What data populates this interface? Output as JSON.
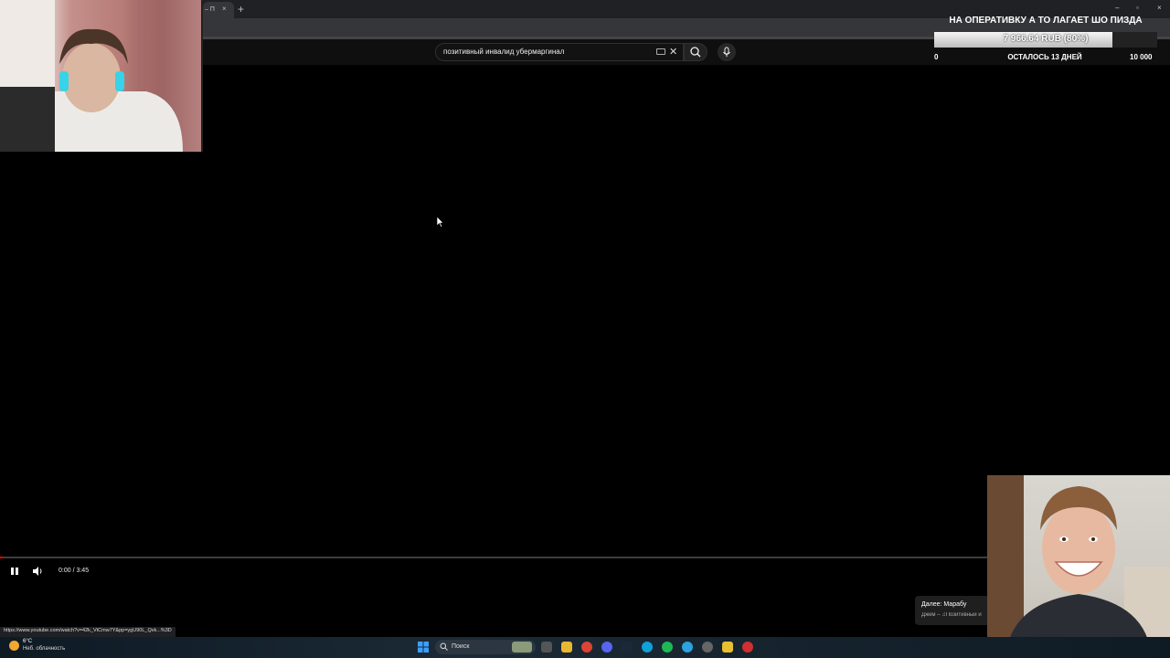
{
  "browser": {
    "tab_label": "– П",
    "tab_close": "×",
    "new_tab": "+",
    "window_buttons": [
      "–",
      "▫",
      "×"
    ]
  },
  "search": {
    "query": "позитивный инвалид убермаргинал",
    "clear_icon": "close-icon",
    "search_icon": "search-icon",
    "mic_icon": "mic-icon"
  },
  "donation_goal": {
    "title": "НА ОПЕРАТИВКУ А ТО ЛАГАЕТ ШО ПИЗДА",
    "amount": "7 966.64 RUB (80%)",
    "progress": 0.8,
    "min": "0",
    "remaining": "ОСТАЛОСЬ 13 ДНЕЙ",
    "max": "10 000"
  },
  "player": {
    "time": "0:00 / 3:45",
    "progress": 0.0,
    "accent_color": "#ff0000"
  },
  "up_next": {
    "title": "Далее: Марабу",
    "subtitle": "Джем – ♫Позитивный и"
  },
  "status_url": "https://www.youtube.com/watch?v=42k_VtCmw7Y&pp=ygU90L_Qvk...%3D",
  "taskbar": {
    "weather_temp": "6°C",
    "weather_desc": "Неб. облачность",
    "search_placeholder": "Поиск"
  }
}
